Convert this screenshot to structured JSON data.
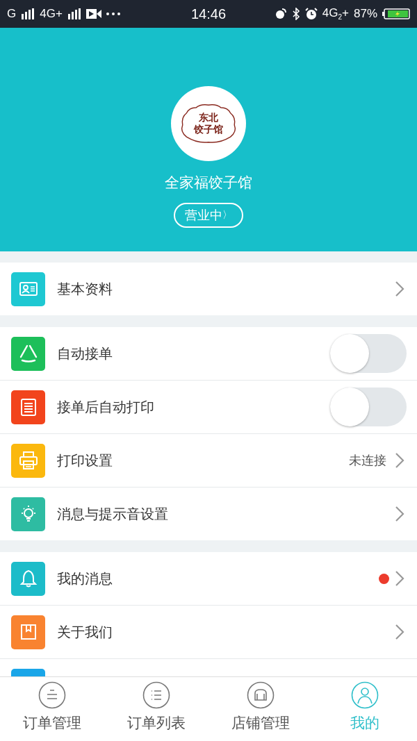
{
  "status_bar": {
    "carrier1": "G",
    "carrier2": "4G+",
    "time": "14:46",
    "network": "4G$_{2}$+",
    "battery": "87%"
  },
  "header": {
    "logo_text": [
      "东北",
      "饺子馆"
    ],
    "shop_name": "全家福饺子馆",
    "status": "营业中",
    "status_chevron": "〉"
  },
  "groups": [
    {
      "items": [
        {
          "label": "基本资料",
          "kind": "chevron"
        }
      ]
    },
    {
      "items": [
        {
          "label": "自动接单",
          "kind": "toggle",
          "on": false
        },
        {
          "label": "接单后自动打印",
          "kind": "toggle",
          "on": false
        },
        {
          "label": "打印设置",
          "kind": "chevron",
          "value": "未连接"
        },
        {
          "label": "消息与提示音设置",
          "kind": "chevron"
        }
      ]
    },
    {
      "items": [
        {
          "label": "我的消息",
          "kind": "chevron",
          "badge": true
        },
        {
          "label": "关于我们",
          "kind": "chevron"
        },
        {
          "kind": "cut"
        }
      ]
    }
  ],
  "tabs": [
    {
      "label": "订单管理",
      "selected": false
    },
    {
      "label": "订单列表",
      "selected": false
    },
    {
      "label": "店铺管理",
      "selected": false
    },
    {
      "label": "我的",
      "selected": true
    }
  ]
}
